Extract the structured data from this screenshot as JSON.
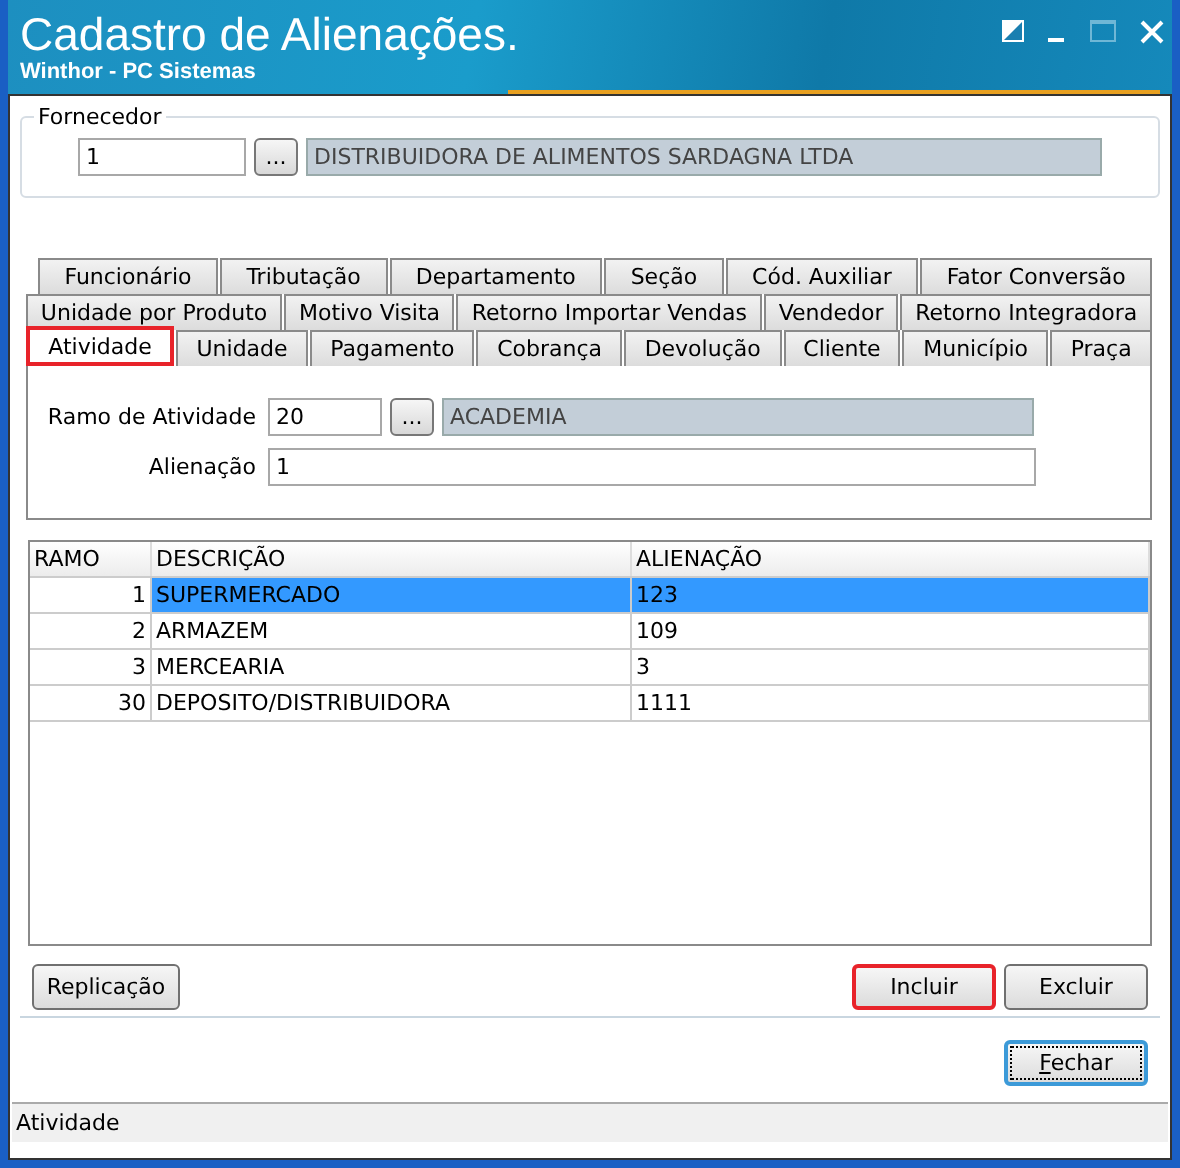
{
  "window": {
    "title": "Cadastro de Alienações.",
    "subtitle": "Winthor - PC Sistemas"
  },
  "fornecedor": {
    "label": "Fornecedor",
    "code": "1",
    "lookup_button": "...",
    "name": "DISTRIBUIDORA DE ALIMENTOS SARDAGNA LTDA"
  },
  "tabs": [
    [
      {
        "label": "Funcionário",
        "selected": false,
        "highlighted": false
      },
      {
        "label": "Tributação",
        "selected": false,
        "highlighted": false
      },
      {
        "label": "Departamento",
        "selected": false,
        "highlighted": false
      },
      {
        "label": "Seção",
        "selected": false,
        "highlighted": false
      },
      {
        "label": "Cód. Auxiliar",
        "selected": false,
        "highlighted": false
      },
      {
        "label": "Fator Conversão",
        "selected": false,
        "highlighted": false
      }
    ],
    [
      {
        "label": "Unidade por Produto",
        "selected": false,
        "highlighted": false
      },
      {
        "label": "Motivo Visita",
        "selected": false,
        "highlighted": false
      },
      {
        "label": "Retorno Importar Vendas",
        "selected": false,
        "highlighted": false
      },
      {
        "label": "Vendedor",
        "selected": false,
        "highlighted": false
      },
      {
        "label": "Retorno Integradora",
        "selected": false,
        "highlighted": false
      }
    ],
    [
      {
        "label": "Atividade",
        "selected": true,
        "highlighted": true
      },
      {
        "label": "Unidade",
        "selected": false,
        "highlighted": false
      },
      {
        "label": "Pagamento",
        "selected": false,
        "highlighted": false
      },
      {
        "label": "Cobrança",
        "selected": false,
        "highlighted": false
      },
      {
        "label": "Devolução",
        "selected": false,
        "highlighted": false
      },
      {
        "label": "Cliente",
        "selected": false,
        "highlighted": false
      },
      {
        "label": "Município",
        "selected": false,
        "highlighted": false
      },
      {
        "label": "Praça",
        "selected": false,
        "highlighted": false
      }
    ]
  ],
  "activity": {
    "ramo_label": "Ramo de Atividade",
    "ramo_code": "20",
    "lookup_button": "...",
    "ramo_name": "ACADEMIA",
    "alienacao_label": "Alienação",
    "alienacao_value": "1"
  },
  "table": {
    "columns": [
      "RAMO",
      "DESCRIÇÃO",
      "ALIENAÇÃO"
    ],
    "rows": [
      {
        "cells": [
          "1",
          "SUPERMERCADO",
          "123"
        ],
        "selected": true
      },
      {
        "cells": [
          "2",
          "ARMAZEM",
          "109"
        ],
        "selected": false
      },
      {
        "cells": [
          "3",
          "MERCEARIA",
          "3"
        ],
        "selected": false
      },
      {
        "cells": [
          "30",
          "DEPOSITO/DISTRIBUIDORA",
          "1111"
        ],
        "selected": false
      }
    ]
  },
  "buttons": [
    {
      "label": "Replicação",
      "highlighted": false
    },
    {
      "label": "Incluir",
      "highlighted": true
    },
    {
      "label": "Excluir",
      "highlighted": false
    }
  ],
  "close_button": {
    "label": "Fechar",
    "focused": true
  },
  "status_bar": "Atividade"
}
